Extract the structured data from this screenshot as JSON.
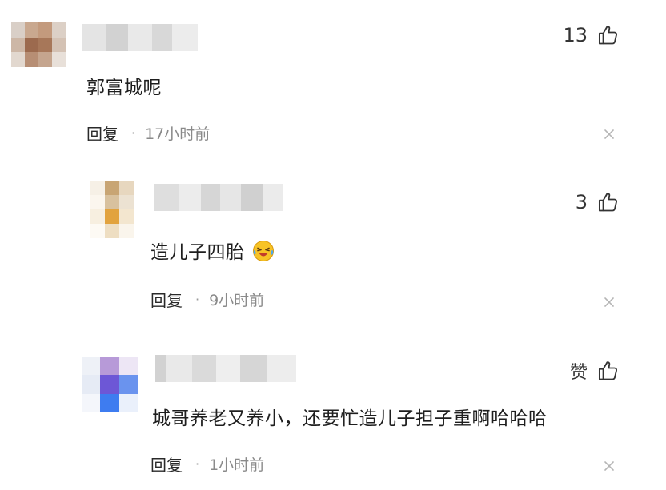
{
  "comments": [
    {
      "text": "郭富城呢",
      "likes": "13",
      "reply_label": "回复",
      "time": "17小时前"
    },
    {
      "text": "造儿子四胎",
      "emoji": "laughing-crying-emoji",
      "likes": "3",
      "reply_label": "回复",
      "time": "9小时前"
    },
    {
      "text": "城哥养老又养小，还要忙造儿子担子重啊哈哈哈",
      "likes": "赞",
      "reply_label": "回复",
      "time": "1小时前"
    }
  ],
  "icons": {
    "like": "thumbs-up-icon",
    "dismiss": "close-icon"
  }
}
